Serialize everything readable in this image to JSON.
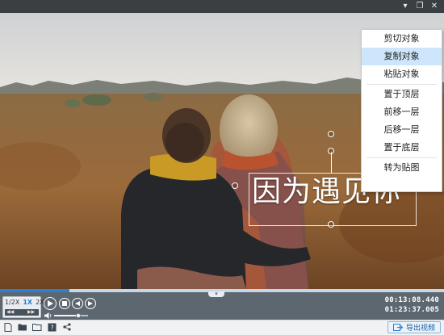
{
  "window": {
    "pin_glyph": "▾",
    "restore_glyph": "❐",
    "close_glyph": "✕"
  },
  "overlay": {
    "text": "因为遇见你"
  },
  "context_menu": {
    "items": [
      {
        "label": "剪切对象"
      },
      {
        "label": "复制对象",
        "active": true
      },
      {
        "label": "粘贴对象"
      },
      {
        "label": "置于顶层"
      },
      {
        "label": "前移一层"
      },
      {
        "label": "后移一层"
      },
      {
        "label": "置于底层"
      },
      {
        "label": "转为贴图"
      }
    ]
  },
  "playback": {
    "progress": 0.157,
    "speeds": [
      "1/2X",
      "1X",
      "2X"
    ],
    "selected_speed": "1X",
    "volume": 0.72,
    "current_time": "00:13:08.440",
    "total_time": "01:23:37.005"
  },
  "toolbar": {
    "icons": [
      "new-file-icon",
      "open-folder-icon",
      "project-folder-icon",
      "help-icon",
      "share-icon"
    ],
    "export_label": "导出视频"
  },
  "colors": {
    "accent": "#2e7fd4",
    "menu_highlight": "#cde6fb",
    "control_bar": "#5d6770"
  }
}
